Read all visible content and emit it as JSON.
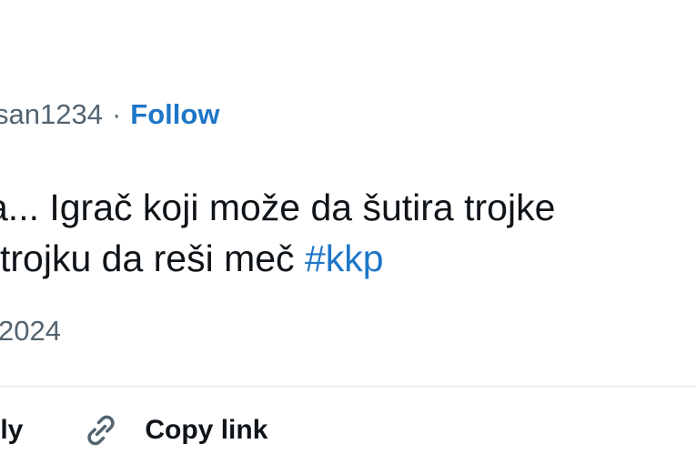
{
  "header": {
    "handle": "san1234",
    "separator": "·",
    "follow_label": "Follow"
  },
  "tweet": {
    "line1": "a... Igrač koji može da šutira trojke",
    "line2": "trojku da reši meč",
    "hashtag": "#kkp",
    "date": "2024"
  },
  "actions": {
    "reply_label": "ply",
    "copy_link_label": "Copy link",
    "copy_link_icon": "link-icon"
  },
  "colors": {
    "accent": "#1d76c8",
    "text": "#0f1419",
    "muted": "#536471"
  }
}
